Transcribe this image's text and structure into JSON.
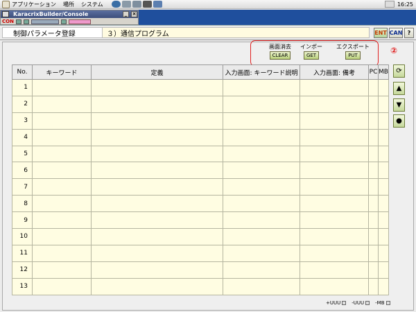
{
  "desktop": {
    "menu": [
      "アプリケーション",
      "場所",
      "システム"
    ],
    "clock": "16:25"
  },
  "console": {
    "title": "KaracrixBuilder/Console",
    "con_label": "CON"
  },
  "header": {
    "screen_title": "制御パラメータ登録",
    "program_title": "３）通信プログラム",
    "ent_label": "ENT",
    "can_label": "CAN",
    "help_label": "?"
  },
  "actions": {
    "clear": {
      "caption": "画面消去",
      "button": "CLEAR"
    },
    "import": {
      "caption": "インポート",
      "button": "GET"
    },
    "export": {
      "caption": "エクスポート",
      "button": "PUT"
    },
    "callout_number": "②"
  },
  "table": {
    "columns": [
      "No.",
      "キーワード",
      "定義",
      "入力画面: キーワード説明",
      "入力画面: 備考",
      "PC",
      "MB"
    ],
    "rows": [
      "1",
      "2",
      "3",
      "4",
      "5",
      "6",
      "7",
      "8",
      "9",
      "10",
      "11",
      "12",
      "13"
    ]
  },
  "side_buttons": [
    "refresh-icon",
    "up-arrow-icon",
    "down-arrow-icon",
    "dot-icon"
  ],
  "bottom": [
    "+UUU",
    "-UUU",
    "-MB"
  ]
}
